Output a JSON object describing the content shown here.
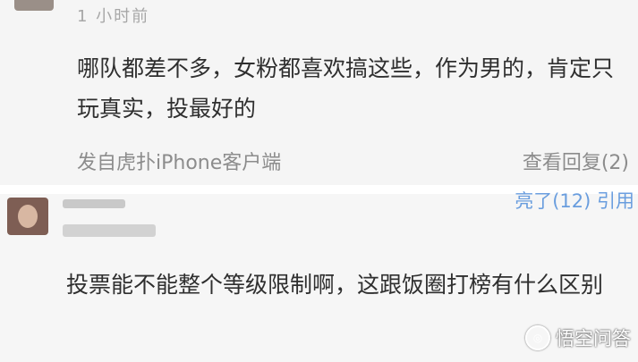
{
  "comment1": {
    "time": "1 小时前",
    "text": "哪队都差不多，女粉都喜欢搞这些，作为男的，肯定只玩真实，投最好的",
    "source": "发自虎扑iPhone客户端",
    "replies": "查看回复(2)"
  },
  "comment2": {
    "actions": "亮了(12)  引用",
    "text": "投票能不能整个等级限制啊，这跟饭圈打榜有什么区别"
  },
  "watermark": {
    "text": "悟空问答"
  }
}
